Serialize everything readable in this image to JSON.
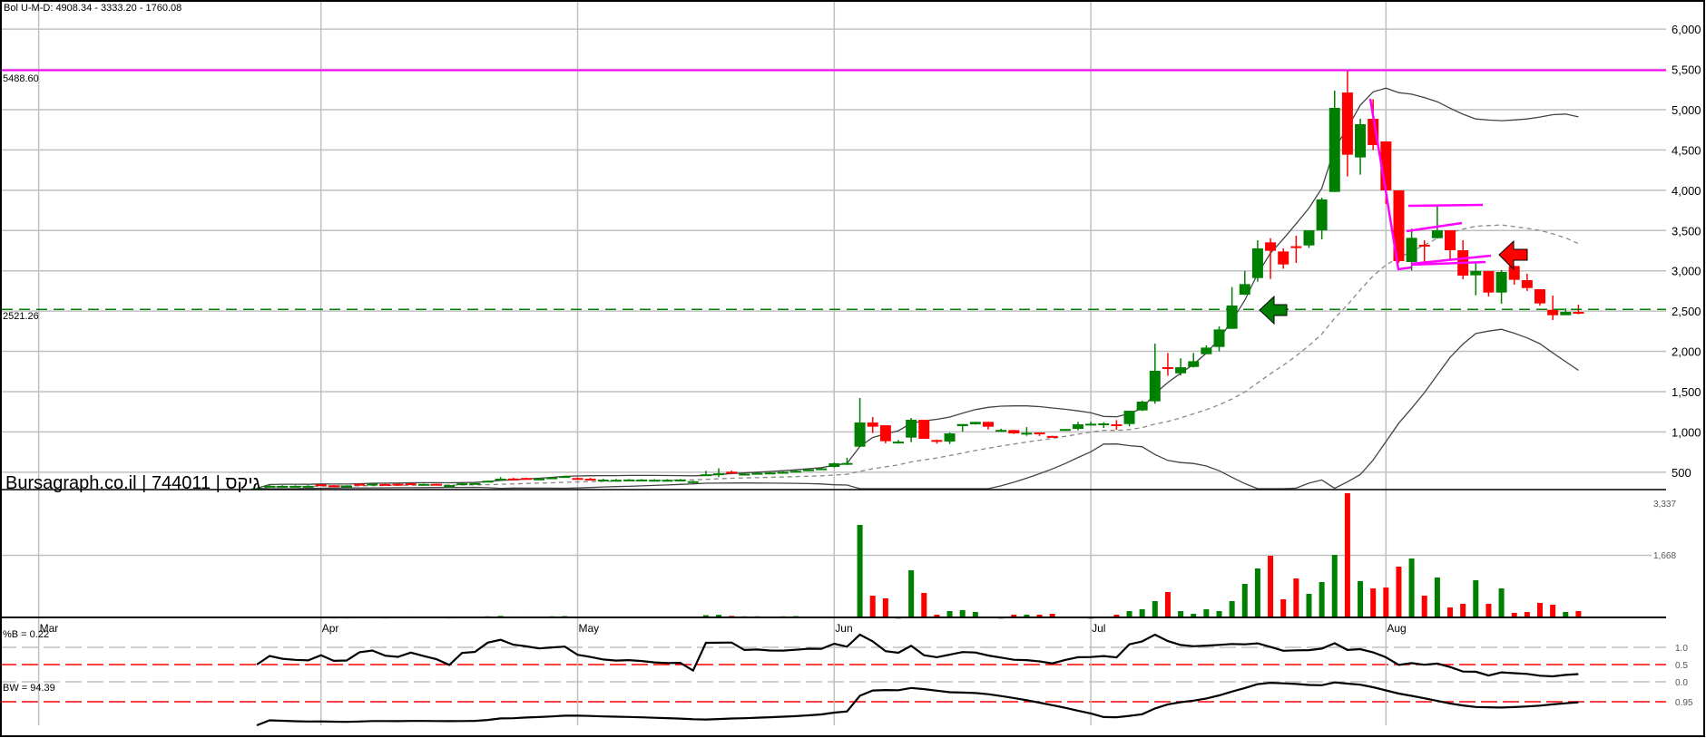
{
  "header": {
    "bollinger_label": "Bol U-M-D: 4908.34 - 3333.20 - 1760.08"
  },
  "watermark": "Bursagraph.co.il | 744011 | גיקס",
  "levels": {
    "resistance": {
      "value": 5488.6,
      "label": "5488.60",
      "color": "#ff00ff"
    },
    "support": {
      "value": 2521.26,
      "label": "2521.26",
      "color": "#008000"
    }
  },
  "colors": {
    "up": "#008000",
    "down": "#ff0000",
    "band": "#444444",
    "trend": "#ff00ff"
  },
  "chart_data": {
    "type": "candlestick",
    "title": "Bursagraph.co.il | 744011 | גיקס",
    "price_axis": {
      "ticks": [
        "6,000",
        "5,500",
        "5,000",
        "4,500",
        "4,000",
        "3,500",
        "3,000",
        "2,500",
        "2,000",
        "1,500",
        "1,000",
        "500"
      ],
      "tick_values": [
        6000,
        5500,
        5000,
        4500,
        4000,
        3500,
        3000,
        2500,
        2000,
        1500,
        1000,
        500
      ],
      "ylim": [
        285,
        6200
      ]
    },
    "months": [
      "Mar",
      "Apr",
      "May",
      "Jun",
      "Jul",
      "Aug"
    ],
    "month_start_index": [
      -17.0,
      5.0,
      25.0,
      45.0,
      65.0,
      88.0
    ],
    "ohlc": [
      [
        292,
        305,
        288,
        300
      ],
      [
        325,
        340,
        320,
        332
      ],
      [
        326,
        338,
        322,
        331
      ],
      [
        326,
        338,
        322,
        331
      ],
      [
        326,
        338,
        322,
        331
      ],
      [
        350,
        352,
        338,
        342
      ],
      [
        338,
        340,
        330,
        334
      ],
      [
        335,
        338,
        330,
        335
      ],
      [
        356,
        358,
        346,
        350
      ],
      [
        350,
        362,
        348,
        358
      ],
      [
        354,
        356,
        348,
        351
      ],
      [
        356,
        358,
        346,
        350
      ],
      [
        362,
        372,
        350,
        360
      ],
      [
        348,
        360,
        346,
        355
      ],
      [
        356,
        358,
        346,
        350
      ],
      [
        336,
        345,
        330,
        340
      ],
      [
        352,
        368,
        350,
        362
      ],
      [
        358,
        370,
        356,
        366
      ],
      [
        380,
        398,
        378,
        394
      ],
      [
        415,
        440,
        412,
        420
      ],
      [
        422,
        430,
        410,
        414
      ],
      [
        428,
        432,
        418,
        420
      ],
      [
        416,
        430,
        414,
        422
      ],
      [
        428,
        440,
        426,
        436
      ],
      [
        446,
        456,
        444,
        452
      ],
      [
        428,
        434,
        420,
        422
      ],
      [
        420,
        430,
        414,
        416
      ],
      [
        404,
        418,
        398,
        408
      ],
      [
        402,
        416,
        396,
        406
      ],
      [
        404,
        414,
        402,
        410
      ],
      [
        404,
        414,
        402,
        409
      ],
      [
        402,
        414,
        400,
        406
      ],
      [
        402,
        414,
        400,
        406
      ],
      [
        404,
        416,
        402,
        409
      ],
      [
        383,
        394,
        380,
        388
      ],
      [
        462,
        518,
        458,
        474
      ],
      [
        470,
        548,
        440,
        486
      ],
      [
        506,
        520,
        490,
        500
      ],
      [
        478,
        488,
        472,
        482
      ],
      [
        486,
        498,
        476,
        492
      ],
      [
        492,
        500,
        488,
        496
      ],
      [
        498,
        512,
        494,
        504
      ],
      [
        510,
        524,
        506,
        518
      ],
      [
        528,
        542,
        524,
        536
      ],
      [
        545,
        550,
        543,
        548
      ],
      [
        566,
        620,
        560,
        611
      ],
      [
        610,
        680,
        590,
        615
      ],
      [
        817,
        1421,
        815,
        1118
      ],
      [
        1118,
        1185,
        986,
        1065
      ],
      [
        1083,
        1083,
        858,
        885
      ],
      [
        877,
        900,
        855,
        880
      ],
      [
        930,
        1174,
        873,
        1151
      ],
      [
        1151,
        1151,
        915,
        915
      ],
      [
        900,
        905,
        855,
        881
      ],
      [
        881,
        992,
        850,
        982
      ],
      [
        1072,
        1098,
        1005,
        1098
      ],
      [
        1095,
        1125,
        1090,
        1125
      ],
      [
        1125,
        1125,
        1030,
        1065
      ],
      [
        1020,
        1040,
        1005,
        1025
      ],
      [
        1023,
        1023,
        975,
        982
      ],
      [
        988,
        1060,
        952,
        990
      ],
      [
        993,
        993,
        950,
        975
      ],
      [
        950,
        952,
        945,
        946
      ],
      [
        1033,
        1038,
        1030,
        1036
      ],
      [
        1038,
        1125,
        1020,
        1095
      ],
      [
        1100,
        1125,
        1090,
        1102
      ],
      [
        1100,
        1120,
        1050,
        1106
      ],
      [
        1095,
        1147,
        1027,
        1090
      ],
      [
        1098,
        1263,
        1070,
        1263
      ],
      [
        1267,
        1390,
        1260,
        1376
      ],
      [
        1380,
        2096,
        1350,
        1759
      ],
      [
        1804,
        1980,
        1698,
        1790
      ],
      [
        1728,
        1914,
        1700,
        1803
      ],
      [
        1807,
        1980,
        1800,
        1878
      ],
      [
        1965,
        2075,
        1965,
        2047
      ],
      [
        2055,
        2310,
        2000,
        2272
      ],
      [
        2280,
        2798,
        2280,
        2569
      ],
      [
        2704,
        2997,
        2700,
        2835
      ],
      [
        2910,
        3379,
        2865,
        3278
      ],
      [
        3353,
        3405,
        2899,
        3248
      ],
      [
        3240,
        3278,
        3026,
        3079
      ],
      [
        3305,
        3435,
        3098,
        3300
      ],
      [
        3315,
        3503,
        3285,
        3503
      ],
      [
        3503,
        3908,
        3390,
        3886
      ],
      [
        3979,
        5236,
        3979,
        5022
      ],
      [
        5213,
        5488,
        4171,
        4441
      ],
      [
        4407,
        4887,
        4193,
        4820
      ],
      [
        4887,
        5130,
        4500,
        4561
      ],
      [
        4606,
        4606,
        3830,
        3998
      ],
      [
        3998,
        3998,
        3100,
        3120
      ],
      [
        3109,
        3522,
        3004,
        3409
      ],
      [
        3323,
        3379,
        3090,
        3300
      ],
      [
        3405,
        3811,
        3400,
        3503
      ],
      [
        3503,
        3503,
        3139,
        3255
      ],
      [
        3255,
        3379,
        2895,
        2940
      ],
      [
        2944,
        3090,
        2696,
        2997
      ],
      [
        2997,
        2997,
        2680,
        2730
      ],
      [
        2730,
        3010,
        2591,
        2985
      ],
      [
        3060,
        3060,
        2828,
        2888
      ],
      [
        2884,
        2964,
        2750,
        2786
      ],
      [
        2771,
        2771,
        2568,
        2595
      ],
      [
        2516,
        2693,
        2389,
        2449
      ],
      [
        2449,
        2535,
        2449,
        2490
      ],
      [
        2490,
        2580,
        2460,
        2470
      ]
    ],
    "volume": [
      20,
      15,
      15,
      15,
      15,
      25,
      10,
      10,
      20,
      15,
      10,
      20,
      25,
      15,
      20,
      10,
      20,
      20,
      30,
      40,
      25,
      25,
      20,
      30,
      35,
      20,
      20,
      15,
      15,
      15,
      15,
      15,
      15,
      15,
      20,
      60,
      70,
      40,
      30,
      30,
      25,
      30,
      35,
      20,
      20,
      20,
      20,
      2485,
      585,
      512,
      5,
      1267,
      658,
      73,
      170,
      195,
      146,
      24,
      5,
      73,
      73,
      73,
      97,
      24,
      24,
      5,
      24,
      73,
      170,
      219,
      438,
      682,
      170,
      97,
      219,
      170,
      438,
      901,
      1315,
      1656,
      487,
      1047,
      633,
      950,
      1680,
      3337,
      974,
      780,
      804,
      1364,
      1583,
      585,
      1072,
      268,
      365,
      998,
      365,
      780,
      122,
      146,
      390,
      341,
      146,
      170
    ],
    "volume_axis": {
      "ticks": [
        "3,337",
        "1,668"
      ],
      "max": 3337
    },
    "bollinger": {
      "period": 20,
      "upper_last": 4908.34,
      "middle_last": 3333.2,
      "lower_last": 1760.08
    },
    "percent_b": {
      "label": "%B = 0.22",
      "ticks": [
        "1.0",
        "0.5",
        "0.0"
      ]
    },
    "bandwidth": {
      "label": "BW = 94.39",
      "ticks": [
        "0.95"
      ]
    }
  }
}
